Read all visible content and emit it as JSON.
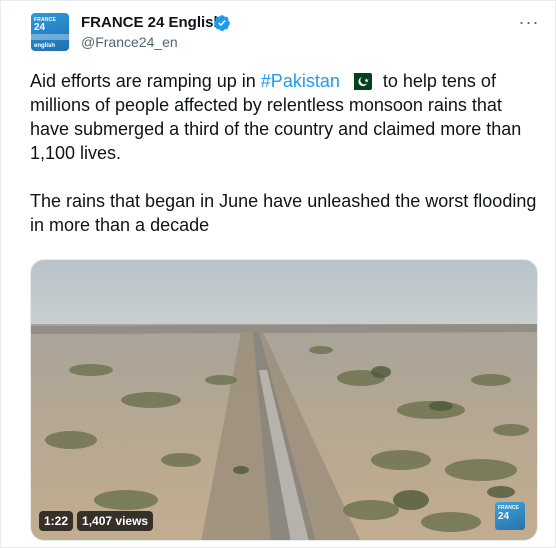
{
  "account": {
    "display_name": "FRANCE 24 English",
    "handle": "@France24_en",
    "verified": true,
    "avatar_logo": {
      "top": "FRANCE",
      "number": "24",
      "bottom": "english"
    }
  },
  "menu": {
    "more_label": "···"
  },
  "tweet": {
    "p1_before": "Aid efforts are ramping up in ",
    "hashtag": "#Pakistan",
    "flag_icon": "pakistan-flag-emoji",
    "p1_after": " to help tens of millions of people affected by relentless monsoon rains that have submerged a third of the country and claimed more than 1,100 lives.",
    "p2": "The rains that began in June have unleashed the worst flooding in more than a decade"
  },
  "media": {
    "type": "video",
    "duration": "1:22",
    "views": "1,407 views",
    "watermark": {
      "top": "FRANCE",
      "number": "24"
    }
  },
  "colors": {
    "hashtag": "#1d9bf0",
    "text": "#0f1419",
    "secondary": "#536471",
    "verified": "#1d9bf0"
  }
}
